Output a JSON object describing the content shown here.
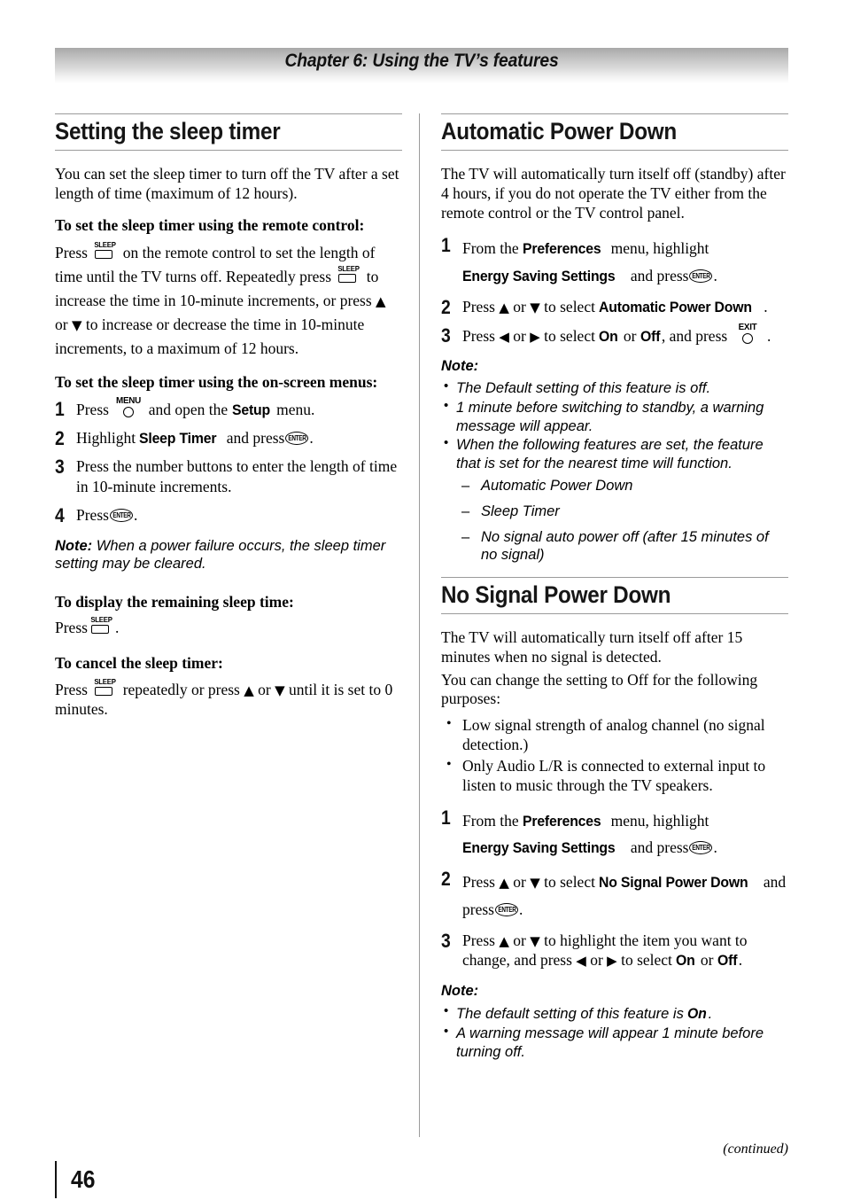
{
  "header": {
    "chapter_title": "Chapter 6: Using the TV’s features"
  },
  "footer": {
    "continued": "(continued)",
    "page_number": "46"
  },
  "icons": {
    "sleep": "SLEEP",
    "menu": "MENU",
    "exit": "EXIT",
    "enter": "ENTER",
    "up": "▲",
    "down": "▼",
    "left": "◀",
    "right": "▶"
  },
  "left_column": {
    "heading": "Setting the sleep timer",
    "intro": "You can set the sleep timer to turn off the TV after a set length of time (maximum of 12 hours).",
    "remote_subhead": "To set the sleep timer using the remote control:",
    "remote_text": {
      "a": "Press",
      "b": "on the remote control to set the length of time until the TV turns off. Repeatedly press",
      "c": "to increase the time in 10-minute increments, or press",
      "d": "or",
      "e": "to increase or decrease the time in 10-minute increments, to a maximum of 12 hours."
    },
    "menus_subhead": "To set the sleep timer using the on-screen menus:",
    "steps": [
      {
        "num": "1",
        "a": "Press",
        "b": "and open the",
        "ui1": "Setup",
        "c": "menu."
      },
      {
        "num": "2",
        "a": "Highlight",
        "ui1": "Sleep Timer",
        "b": "and press",
        "c": "."
      },
      {
        "num": "3",
        "a": "Press the number buttons to enter the length of time in 10-minute increments."
      },
      {
        "num": "4",
        "a": "Press",
        "c": "."
      }
    ],
    "note": {
      "label": "Note:",
      "text": "When a power failure occurs, the sleep timer setting may be cleared."
    },
    "display_subhead": "To display the remaining sleep time:",
    "display_text": {
      "a": "Press",
      "b": "."
    },
    "cancel_subhead": "To cancel the sleep timer:",
    "cancel_text": {
      "a": "Press",
      "b": "repeatedly or press",
      "c": "or",
      "d": "until it is set to 0 minutes."
    }
  },
  "right_column": {
    "apd": {
      "heading": "Automatic Power Down",
      "intro": "The TV will automatically turn itself off (standby) after 4 hours, if you do not operate the TV either from the remote control or the TV control panel.",
      "steps": [
        {
          "num": "1",
          "a": "From the",
          "ui1": "Preferences",
          "b": "menu, highlight",
          "ui2": "Energy Saving Settings",
          "c": "and press",
          "d": "."
        },
        {
          "num": "2",
          "a": "Press",
          "b": "or",
          "c": "to select",
          "ui1": "Automatic Power Down",
          "d": "."
        },
        {
          "num": "3",
          "a": "Press",
          "b": "or",
          "c": "to select",
          "ui1": "On",
          "d": "or",
          "ui2": "Off",
          "e": ", and press",
          "f": "."
        }
      ],
      "note_heading": "Note:",
      "note_bullets": [
        "The Default setting of this feature is off.",
        "1 minute before switching to standby, a warning message will appear.",
        "When the following features are set, the feature that is set for the nearest time will function."
      ],
      "note_sub_bullets": [
        "Automatic Power Down",
        "Sleep Timer",
        "No signal auto power off (after 15 minutes of no signal)"
      ]
    },
    "nspd": {
      "heading": "No Signal Power Down",
      "intro_1": "The TV will automatically turn itself off after 15 minutes when no signal is detected.",
      "intro_2": "You can change the setting to Off for the following purposes:",
      "bullets": [
        "Low signal strength of analog channel (no signal detection.)",
        "Only Audio L/R is connected to external input to listen to music through the TV speakers."
      ],
      "steps": [
        {
          "num": "1",
          "a": "From the",
          "ui1": "Preferences",
          "b": "menu, highlight",
          "ui2": "Energy Saving Settings",
          "c": "and press",
          "d": "."
        },
        {
          "num": "2",
          "a": "Press",
          "b": "or",
          "c": "to select",
          "ui1": "No Signal Power Down",
          "d": "and press",
          "e": "."
        },
        {
          "num": "3",
          "a": "Press",
          "b": "or",
          "c": "to highlight the item you want to change, and press",
          "d": "or",
          "e": "to select",
          "ui1": "On",
          "f": "or",
          "ui2": "Off",
          "g": "."
        }
      ],
      "note_heading": "Note:",
      "note_bullets_1": {
        "a": "The default setting of this feature is",
        "ui1": "On",
        "b": "."
      },
      "note_bullets_2": "A warning message will appear 1 minute before turning off."
    }
  }
}
